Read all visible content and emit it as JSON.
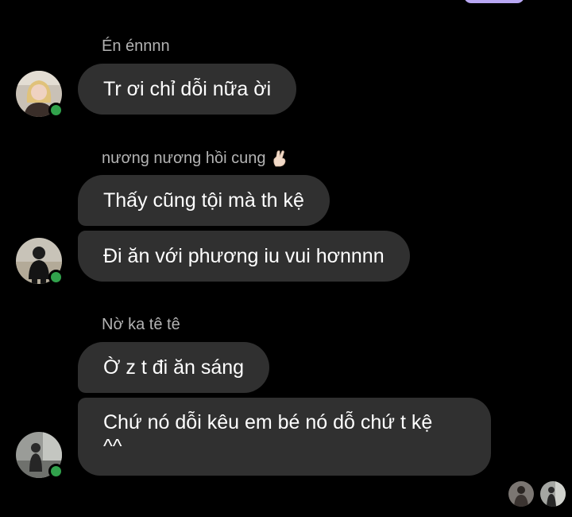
{
  "colors": {
    "background": "#000000",
    "bubble": "#303030",
    "sender_name": "#b3b3b3",
    "online": "#31a24c",
    "accent_pill": "#b9a8f4"
  },
  "messages": [
    {
      "sender": "Én énnnn",
      "avatar_icon": "user-avatar-1",
      "online": true,
      "bubbles": [
        "Tr ơi chỉ dỗi nữa ời"
      ]
    },
    {
      "sender": "nương nương hồi cung",
      "sender_icon": "crossed-fingers-emoji",
      "avatar_icon": "user-avatar-2",
      "online": true,
      "bubbles": [
        "Thấy cũng tội mà th kệ",
        "Đi ăn với phương iu vui hơnnnn"
      ]
    },
    {
      "sender": "Nờ ka tê tê",
      "avatar_icon": "user-avatar-3",
      "online": true,
      "bubbles": [
        "Ờ z t đi ăn sáng",
        "Chứ nó dỗi kêu em bé nó dỗ chứ t kệ\n^^"
      ]
    }
  ],
  "seen_by": [
    "seen-avatar-1",
    "seen-avatar-2"
  ]
}
